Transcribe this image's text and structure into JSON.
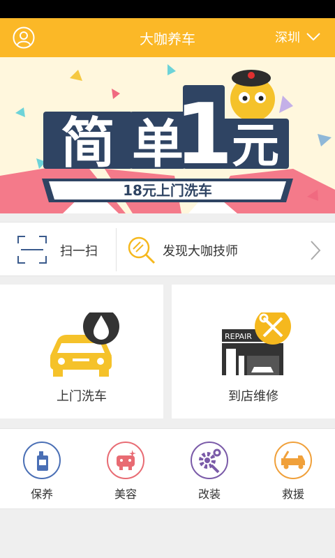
{
  "header": {
    "title": "大咖养车",
    "city": "深圳"
  },
  "banner": {
    "headline_char1": "简",
    "headline_char2": "单",
    "headline_num": "1",
    "headline_char3": "元",
    "subtitle": "18元上门洗车"
  },
  "quick": {
    "scan_label": "扫一扫",
    "discover_label": "发现大咖技师"
  },
  "cards": {
    "wash_label": "上门洗车",
    "repair_label": "到店维修",
    "repair_sign": "REPAIR"
  },
  "services": [
    {
      "label": "保养",
      "icon": "oil-bottle-icon",
      "color": "#4a6fb5"
    },
    {
      "label": "美容",
      "icon": "car-face-icon",
      "color": "#e86b73"
    },
    {
      "label": "改装",
      "icon": "gear-wrench-icon",
      "color": "#7a5aa8"
    },
    {
      "label": "救援",
      "icon": "tow-truck-icon",
      "color": "#f0a03a"
    }
  ],
  "colors": {
    "brand": "#fbb827",
    "text": "#333333"
  }
}
